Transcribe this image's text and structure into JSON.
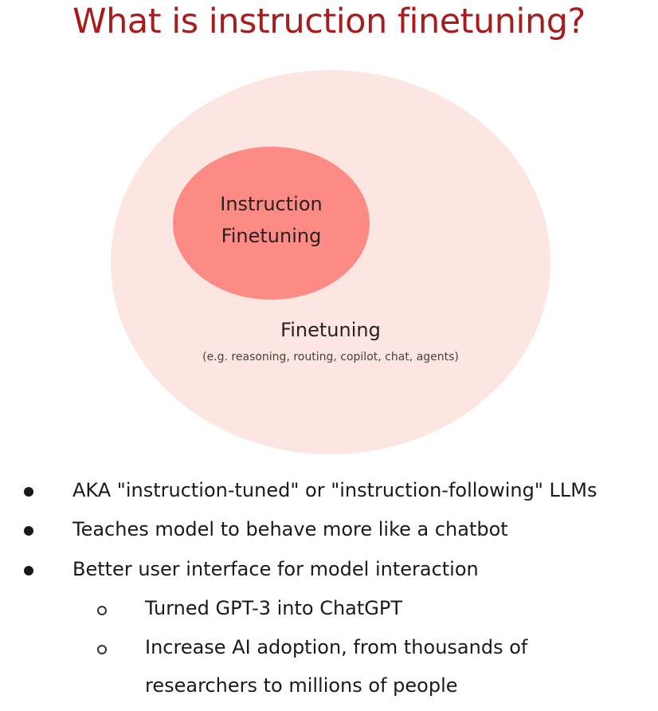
{
  "title": "What is instruction finetuning?",
  "diagram": {
    "inner_label_line1": "Instruction",
    "inner_label_line2": "Finetuning",
    "outer_label": "Finetuning",
    "outer_sublabel": "(e.g. reasoning, routing, copilot, chat, agents)",
    "colors": {
      "title": "#a51d1d",
      "outer_fill": "#fde6e2",
      "inner_fill": "#fd8b85"
    }
  },
  "bullets": [
    {
      "text": "AKA \"instruction-tuned\" or \"instruction-following\" LLMs"
    },
    {
      "text": "Teaches model to behave more like a chatbot"
    },
    {
      "text": "Better user interface for model interaction"
    }
  ],
  "sub_bullets": [
    {
      "lines": [
        "Turned GPT-3 into ChatGPT"
      ]
    },
    {
      "lines": [
        "Increase AI adoption, from thousands of",
        "researchers to millions of people"
      ]
    }
  ]
}
